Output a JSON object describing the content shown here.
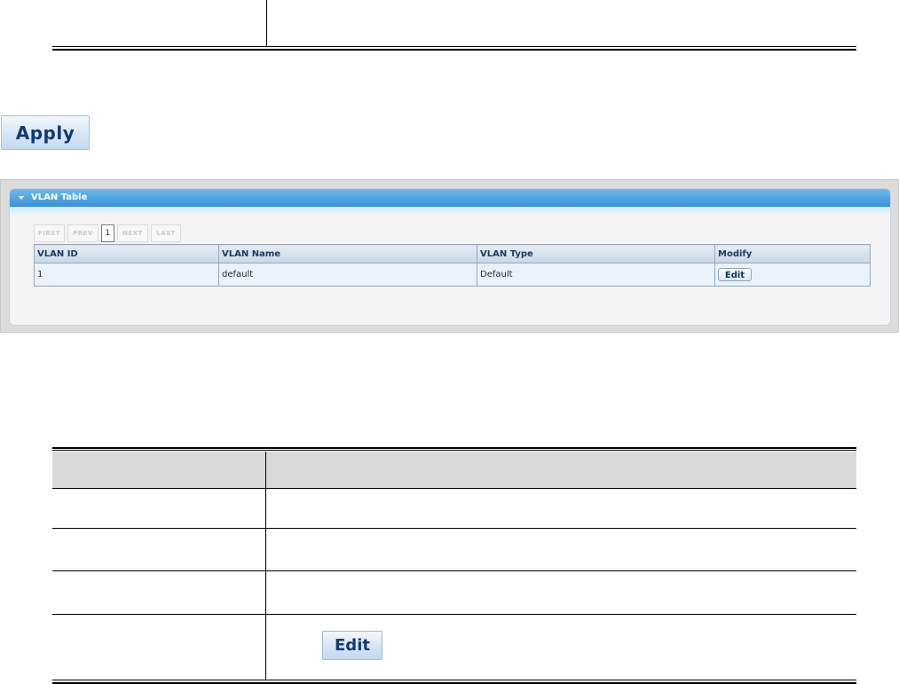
{
  "apply_button": {
    "label": "Apply"
  },
  "vlan_panel": {
    "title": "VLAN Table",
    "pager": {
      "first": "FIRST",
      "prev": "PREV",
      "current": "1",
      "next": "NEXT",
      "last": "LAST"
    },
    "columns": [
      "VLAN ID",
      "VLAN Name",
      "VLAN Type",
      "Modify"
    ],
    "rows": [
      {
        "vlan_id": "1",
        "vlan_name": "default",
        "vlan_type": "Default",
        "modify": "Edit"
      }
    ]
  },
  "description_table": {
    "edit_button_label": "Edit"
  },
  "colors": {
    "panel_header": "#3a96db",
    "table_header": "#c9d7e6",
    "row_background": "#e9f2fb",
    "button_text": "#0f3a78"
  }
}
